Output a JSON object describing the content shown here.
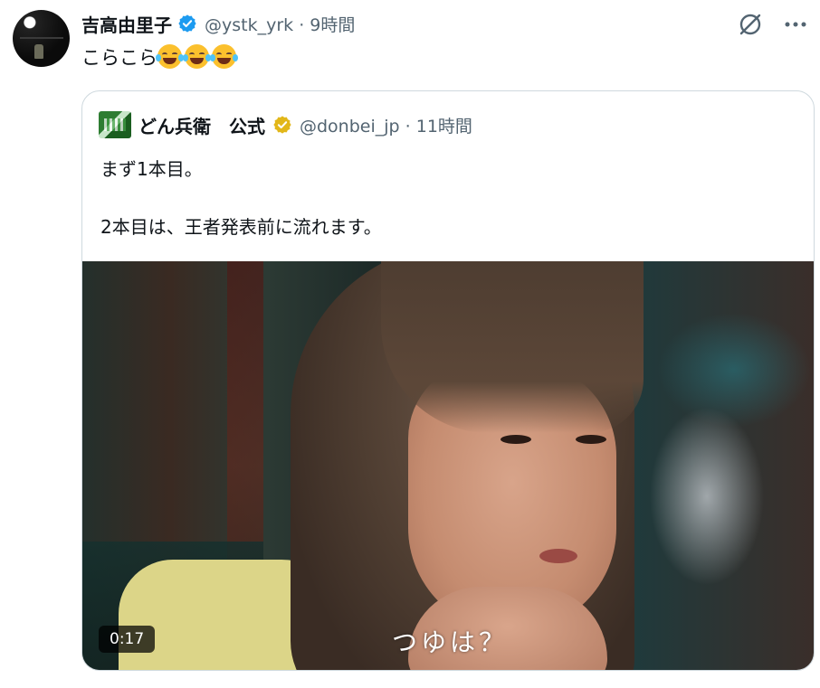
{
  "tweet": {
    "display_name": "吉高由里子",
    "handle": "@ystk_yrk",
    "time": "9時間",
    "text": "こらこら",
    "emoji_count": 3,
    "emoji_name": "face-with-tears-of-joy"
  },
  "quote": {
    "display_name": "どん兵衛　公式",
    "handle": "@donbei_jp",
    "time": "11時間",
    "line1": "まず1本目。",
    "line2": "2本目は、王者発表前に流れます。",
    "video": {
      "duration": "0:17",
      "subtitle": "つゆは？"
    }
  },
  "colors": {
    "verified_blue": "#1d9bf0",
    "verified_gold": "#e2b719",
    "secondary_text": "#536471",
    "card_border": "#cfd9de"
  },
  "icons": {
    "top_action_1": "grok-slash-circle-icon",
    "top_action_2": "more-dots-icon"
  }
}
